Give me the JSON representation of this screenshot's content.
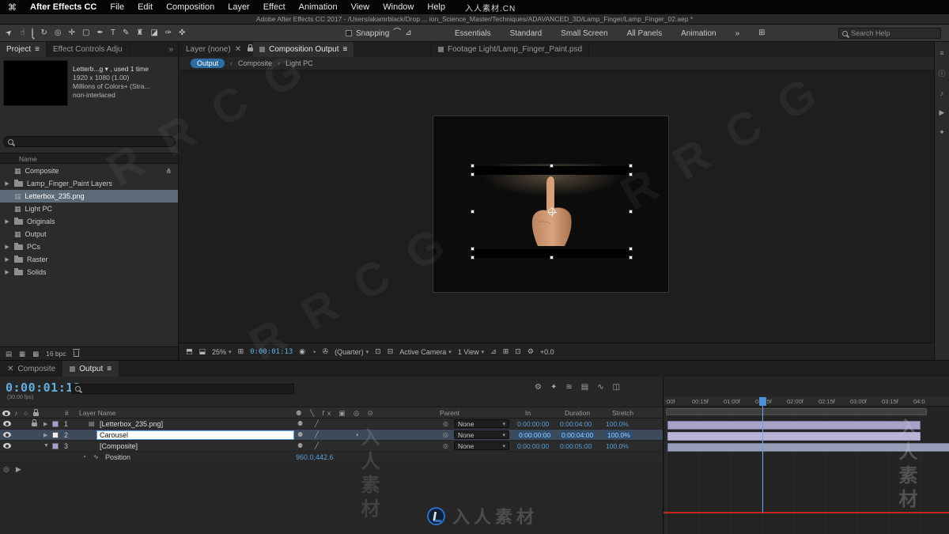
{
  "menubar": {
    "app": "After Effects CC",
    "items": [
      "File",
      "Edit",
      "Composition",
      "Layer",
      "Effect",
      "Animation",
      "View",
      "Window",
      "Help"
    ]
  },
  "titlebar": "Adobe After Effects CC 2017 - /Users/akamrblack/Drop ... ion_Science_Master/Techniques/ADAVANCED_3D/Lamp_Finger/Lamp_Finger_02.aep *",
  "toolbar": {
    "snapping": "Snapping",
    "workspaces": [
      "Essentials",
      "Standard",
      "Small Screen",
      "All Panels",
      "Animation"
    ],
    "overflow": "»",
    "search_placeholder": "Search Help"
  },
  "project": {
    "tab_project": "Project",
    "tab_effects": "Effect Controls Adju",
    "overflow": "»",
    "info_line1": "Letterb...g ▾ , used 1 time",
    "info_line2": "1920 x 1080 (1.00)",
    "info_line3": "Millions of Colors+ (Stra...",
    "info_line4": "non-interlaced",
    "name_header": "Name",
    "items": [
      {
        "label": "Composite",
        "type": "composition"
      },
      {
        "label": "Lamp_Finger_Paint Layers",
        "type": "folder"
      },
      {
        "label": "Letterbox_235.png",
        "type": "footage"
      },
      {
        "label": "Light PC",
        "type": "composition"
      },
      {
        "label": "Originals",
        "type": "folder"
      },
      {
        "label": "Output",
        "type": "composition"
      },
      {
        "label": "PCs",
        "type": "folder"
      },
      {
        "label": "Raster",
        "type": "folder"
      },
      {
        "label": "Solids",
        "type": "folder"
      }
    ],
    "bpc": "16 bpc"
  },
  "viewer": {
    "tab_layer": "Layer (none)",
    "tab_comp": "Composition Output",
    "tab_footage": "Footage Light/Lamp_Finger_Paint.psd",
    "crumb_current": "Output",
    "crumb_sep": "‹",
    "crumb_mid": "Composite",
    "crumb_last": "Light PC",
    "zoom": "25%",
    "time": "0:00:01:13",
    "resolution": "(Quarter)",
    "camera": "Active Camera",
    "view": "1 View",
    "exposure": "+0.0"
  },
  "timeline": {
    "tab_composite": "Composite",
    "tab_output": "Output",
    "timecode": "0:00:01:13",
    "fps": "(30.00 fps)",
    "col_num": "#",
    "col_name": "Layer Name",
    "col_parent": "Parent",
    "col_in": "In",
    "col_duration": "Duration",
    "col_stretch": "Stretch",
    "layers": [
      {
        "num": "1",
        "name": "[Letterbox_235.png]",
        "parent": "None",
        "tin": "0:00:00:00",
        "dur": "0:00:04:00",
        "stretch": "100.0%"
      },
      {
        "num": "2",
        "name": "Carousel",
        "parent": "None",
        "tin": "0:00:00:00",
        "dur": "0:00:04:00",
        "stretch": "100.0%"
      },
      {
        "num": "3",
        "name": "[Composite]",
        "parent": "None",
        "tin": "0:00:00:00",
        "dur": "0:00:05:00",
        "stretch": "100.0%"
      }
    ],
    "prop_name": "Position",
    "prop_value": "960.0,442.6",
    "ruler": [
      ":00f",
      "00:15f",
      "01:00f",
      "01:15f",
      "02:00f",
      "02:15f",
      "03:00f",
      "03:15f",
      "04:0"
    ]
  },
  "watermarks": {
    "corner": "入人素材.CN",
    "diag": "RRCG",
    "vertical": "入人素材",
    "brand": "入人素材"
  },
  "icons": {
    "apple": "⌘",
    "selection": "➤",
    "hand": "☝",
    "rotate": "↻",
    "orbit": "◎",
    "pan": "✛",
    "mask": "▢",
    "pen": "✒",
    "type": "T",
    "brush": "✎",
    "stamp": "♜",
    "eraser": "◪",
    "roto": "✑",
    "puppet": "✜",
    "snap_a": "⌒",
    "snap_b": "⊿",
    "grid": "⊞",
    "burger": "≡",
    "close": "✕",
    "caret": "▾",
    "tw_closed": "▶",
    "tw_open": "▼",
    "comp": "▦",
    "file": "▤",
    "badge": "⋔",
    "audio": "♪",
    "solo": "○",
    "switches_header": "⚉ ╲ fx ▣ ◎ ⊙",
    "row_switch_a": "⚉",
    "row_switch_b": "╱",
    "row_switch_c": "◐",
    "pickwhip": "◎",
    "stopwatch": "◔",
    "graph": "∿",
    "monitor1": "⬒",
    "monitor2": "⬓",
    "camera": "◉",
    "clock": "◔",
    "snail": "✇",
    "view_a": "⊡",
    "view_b": "⊟",
    "gear": "⚙",
    "tl_a": "⚙",
    "tl_b": "✦",
    "tl_c": "≋",
    "tl_d": "▤",
    "tl_e": "∿",
    "tl_f": "◫",
    "dock_a": "≡",
    "dock_b": "ⓘ",
    "dock_c": "♪",
    "dock_d": "▶",
    "dock_e": "✦",
    "proj_a": "▤",
    "proj_b": "▦",
    "proj_c": "▩"
  }
}
